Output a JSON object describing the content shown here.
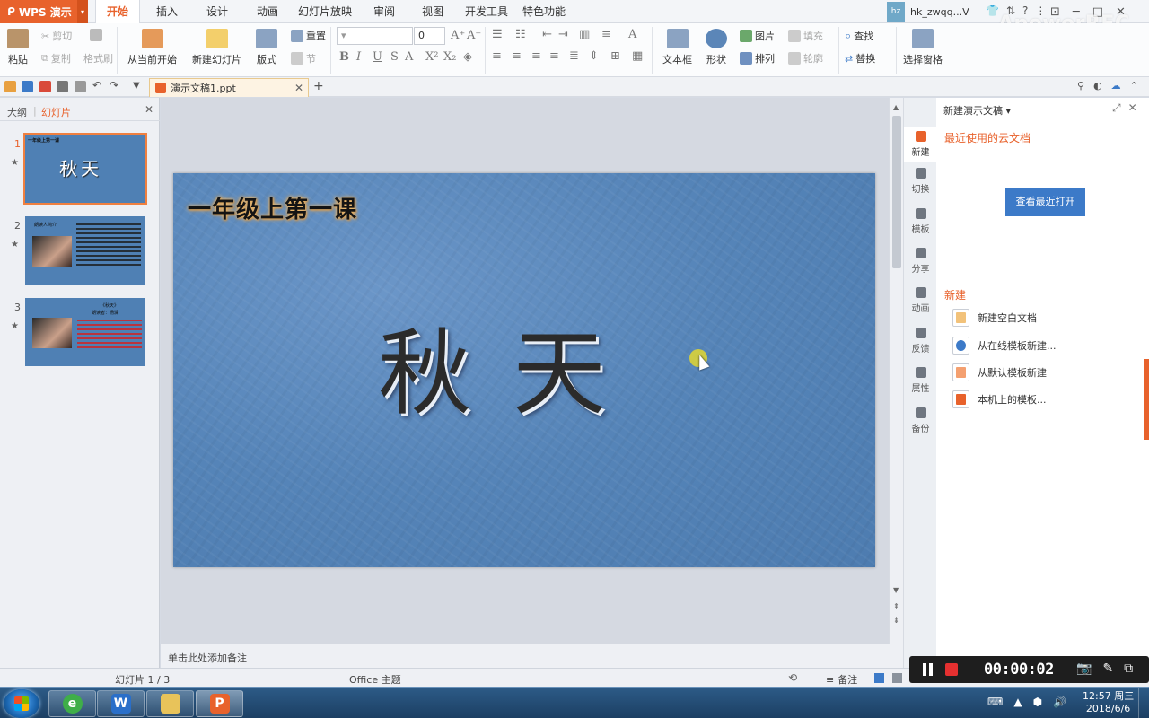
{
  "app": {
    "name": "WPS 演示"
  },
  "menu": [
    "开始",
    "插入",
    "设计",
    "动画",
    "幻灯片放映",
    "审阅",
    "视图",
    "开发工具",
    "特色功能"
  ],
  "user": {
    "avatar": "hz",
    "name": "hk_zwqq...V"
  },
  "watermark": "ApowerREC",
  "ribbon": {
    "paste": "粘贴",
    "cut": "剪切",
    "copy": "复制",
    "format_painter": "格式刷",
    "from_current": "从当前开始",
    "new_slide": "新建幻灯片",
    "layout": "版式",
    "reset": "重置",
    "section": "节",
    "font_size": "0",
    "text_box": "文本框",
    "shape": "形状",
    "picture": "图片",
    "fill": "填充",
    "arrange": "排列",
    "outline": "轮廓",
    "find": "查找",
    "replace": "替换",
    "select_pane": "选择窗格"
  },
  "doc_tab": {
    "title": "演示文稿1.ppt"
  },
  "left_panel": {
    "tab_outline": "大纲",
    "tab_slides": "幻灯片",
    "slides": [
      {
        "num": "1",
        "mini_title": "一年级上第一课",
        "mini_big": "秋天"
      },
      {
        "num": "2",
        "mini_title": "朗读人简介"
      },
      {
        "num": "3",
        "mini_title": "《秋天》",
        "mini_sub": "朗读者：杨澜"
      }
    ]
  },
  "slide": {
    "subtitle": "一年级上第一课",
    "title": "秋天"
  },
  "notes": {
    "placeholder": "单击此处添加备注"
  },
  "rail": [
    "新建",
    "切换",
    "模板",
    "分享",
    "动画",
    "反馈",
    "属性",
    "备份"
  ],
  "task_pane": {
    "header": "新建演示文稿",
    "cloud_docs": "最近使用的云文档",
    "open_recent": "查看最近打开",
    "new_section": "新建",
    "items": [
      "新建空白文档",
      "从在线模板新建...",
      "从默认模板新建",
      "本机上的模板..."
    ]
  },
  "status": {
    "slide_info": "幻灯片 1 / 3",
    "theme": "Office 主题",
    "notes_btn": "备注"
  },
  "recorder": {
    "time": "00:00:02"
  },
  "taskbar": {
    "word_letter": "W",
    "ppt_letter": "P"
  },
  "clock": {
    "time": "12:57 周三",
    "date": "2018/6/6"
  }
}
